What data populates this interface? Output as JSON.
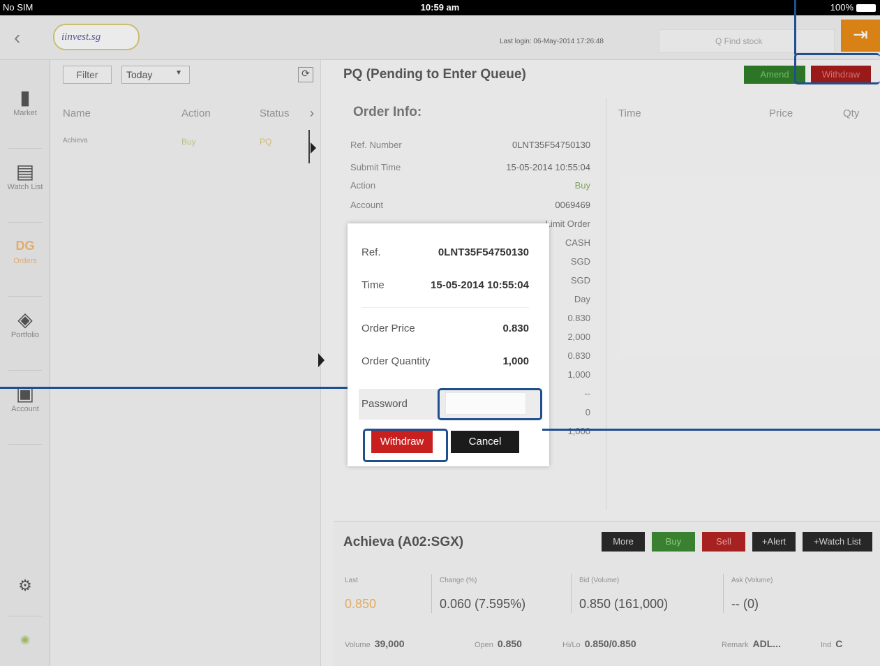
{
  "status_bar": {
    "carrier": "No SIM",
    "time": "10:59 am",
    "battery": "100%"
  },
  "header": {
    "back_glyph": "‹",
    "logo_text": "iinvest.sg",
    "last_login": "Last login: 06-May-2014 17:26:48",
    "search_placeholder": "Q  Find stock",
    "logout_glyph": "⇥"
  },
  "sidebar": {
    "items": [
      {
        "label": "Market",
        "icon": "bar-chart-icon",
        "glyph": "▮"
      },
      {
        "label": "Watch List",
        "icon": "list-icon",
        "glyph": "▤"
      },
      {
        "label": "Orders",
        "icon": "orders-icon",
        "glyph": "DG"
      },
      {
        "label": "Portfolio",
        "icon": "layers-icon",
        "glyph": "◈"
      },
      {
        "label": "Account",
        "icon": "account-icon",
        "glyph": "▣"
      }
    ],
    "settings_glyph": "⚙",
    "connection_glyph": "◉"
  },
  "orders_list": {
    "filter_label": "Filter",
    "period_value": "Today",
    "refresh_glyph": "⟳",
    "columns": [
      "Name",
      "Action",
      "Status"
    ],
    "rows": [
      {
        "name": "Achieva",
        "action": "Buy",
        "status": "PQ"
      }
    ]
  },
  "detail": {
    "title": "PQ (Pending to Enter Queue)",
    "amend_label": "Amend",
    "withdraw_label": "Withdraw",
    "order_info_heading": "Order Info:",
    "info_rows": [
      {
        "k": "Ref. Number",
        "v": "0LNT35F54750130"
      },
      {
        "k": "Submit Time",
        "v": "15-05-2014 10:55:04"
      },
      {
        "k": "Action",
        "v": "Buy"
      },
      {
        "k": "Account",
        "v": "0069469"
      }
    ],
    "more_values": [
      "Limit Order",
      "CASH",
      "SGD",
      "SGD",
      "Day",
      "0.830",
      "2,000",
      "0.830",
      "1,000",
      "--",
      "0",
      "1,000"
    ],
    "right_columns": [
      "Time",
      "Price",
      "Qty"
    ]
  },
  "stock": {
    "name": "Achieva (A02:SGX)",
    "buttons": [
      "More",
      "Buy",
      "Sell",
      "+Alert",
      "+Watch List"
    ],
    "quote": [
      {
        "label": "Last",
        "value": "0.850"
      },
      {
        "label": "Change (%)",
        "value": "0.060 (7.595%)"
      },
      {
        "label": "Bid (Volume)",
        "value": "0.850 (161,000)"
      },
      {
        "label": "Ask (Volume)",
        "value": "-- (0)"
      }
    ],
    "bottom": [
      {
        "label": "Volume",
        "value": "39,000"
      },
      {
        "label": "Open",
        "value": "0.850"
      },
      {
        "label": "Hi/Lo",
        "value": "0.850/0.850"
      },
      {
        "label": "Remark",
        "value": "ADL..."
      },
      {
        "label": "Ind",
        "value": "C"
      }
    ]
  },
  "popup": {
    "ref_label": "Ref.",
    "ref_value": "0LNT35F54750130",
    "time_label": "Time",
    "time_value": "15-05-2014 10:55:04",
    "price_label": "Order Price",
    "price_value": "0.830",
    "qty_label": "Order Quantity",
    "qty_value": "1,000",
    "password_label": "Password",
    "withdraw_label": "Withdraw",
    "cancel_label": "Cancel"
  },
  "colors": {
    "annotation": "#1f4f8f",
    "withdraw": "#c81f1f",
    "buy": "#2f7d2a",
    "orange": "#e68a16"
  }
}
